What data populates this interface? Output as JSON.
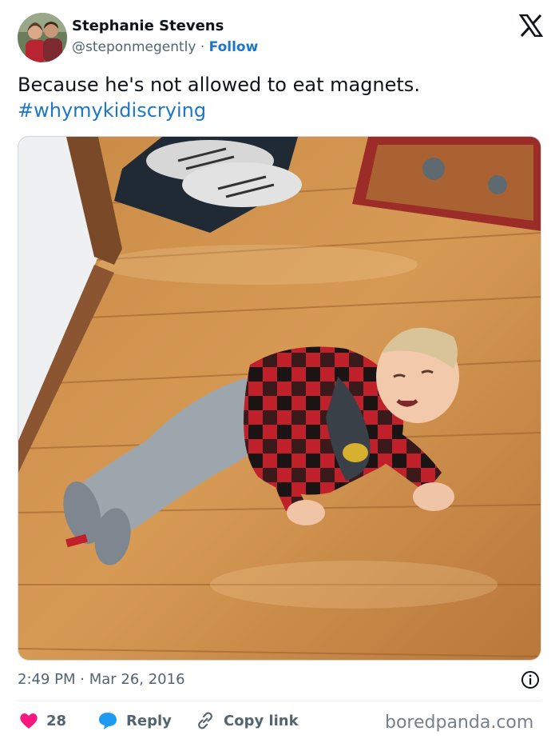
{
  "tweet": {
    "author": {
      "display_name": "Stephanie Stevens",
      "handle": "@steponmegently",
      "separator": " · ",
      "follow_label": "Follow"
    },
    "platform_icon": "x-logo-icon",
    "text": "Because he's not allowed to eat magnets.",
    "hashtag": "#whymykidiscrying",
    "timestamp": "2:49 PM · Mar 26, 2016",
    "info_icon": "info-icon",
    "actions": {
      "likes_count": "28",
      "reply_label": "Reply",
      "copy_link_label": "Copy link"
    }
  },
  "watermark": "boredpanda.com",
  "colors": {
    "link_blue": "#1d76c9",
    "heart_red": "#f91880",
    "reply_blue": "#1d9bf0",
    "muted_text": "#536471"
  }
}
